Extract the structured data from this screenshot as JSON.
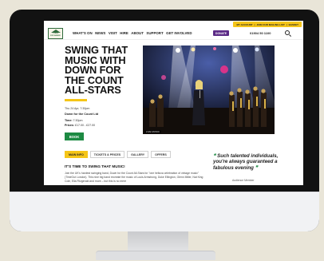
{
  "utility": {
    "account": "MY ACCOUNT",
    "mailing": "JOIN OUR MAILING LIST",
    "basket": "BASKET"
  },
  "logo": {
    "line1": "CORN",
    "line2": "EXCHANGE"
  },
  "nav": {
    "items": [
      "WHAT'S ON",
      "NEWS",
      "VISIT",
      "HIRE",
      "ABOUT",
      "SUPPORT",
      "GET INVOLVED"
    ],
    "donate": "DONATE",
    "phone": "01904 50 1100"
  },
  "event": {
    "title": "SWING THAT MUSIC WITH DOWN FOR THE COUNT ALL-STARS",
    "date": "Thu 24 Apr, 7:30pm",
    "venue": "Down for the Count Ltd",
    "time_label": "Time:",
    "time_value": "7:30pm",
    "price_label": "Prices:",
    "price_value": "£17.00 - £27.00",
    "book_label": "BOOK",
    "image_caption": "LIVE MUSIC"
  },
  "tabs": [
    "MAIN INFO",
    "TICKETS & PRICES",
    "GALLERY",
    "OFFERS"
  ],
  "content": {
    "heading": "IT'S TIME TO SWING THAT MUSIC!",
    "body": "Join the UK's hardest swinging band, Down for the Count All-Stars for \"one helluva celebration of vintage music\" (TimeOut London). This nine big band recreate the music of Louis Armstrong, Duke Ellington, Glenn Miller, Nat King Cole, Ella Fitzgerald and more – but this is no mere"
  },
  "quote": {
    "open": "❝",
    "text": "Such talented individuals, you're always guaranteed a fabulous evening",
    "close": "❞",
    "attribution": "Audience Member"
  }
}
